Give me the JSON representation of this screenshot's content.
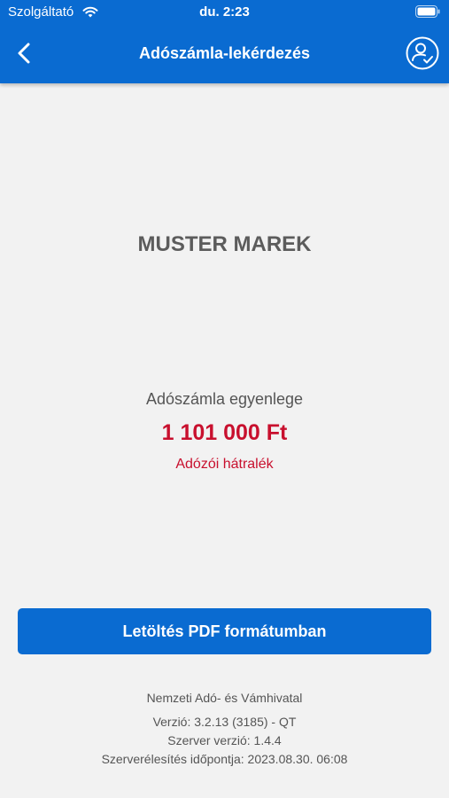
{
  "status_bar": {
    "carrier": "Szolgáltató",
    "time": "du. 2:23"
  },
  "header": {
    "title": "Adószámla-lekérdezés",
    "back_icon": "chevron-left-icon",
    "profile_icon": "user-check-icon"
  },
  "account": {
    "holder_name": "MUSTER MAREK",
    "balance_label": "Adószámla egyenlege",
    "balance_amount": "1 101 000 Ft",
    "balance_status": "Adózói hátralék"
  },
  "actions": {
    "download_label": "Letöltés PDF formátumban"
  },
  "footer": {
    "agency": "Nemzeti Adó- és Vámhivatal",
    "version": "Verzió: 3.2.13 (3185) - QT",
    "server_version": "Szerver verzió: 1.4.4",
    "server_reach_time": "Szerverélesítés időpontja: 2023.08.30. 06:08"
  },
  "colors": {
    "primary": "#0a6bd1",
    "debt": "#c8102e",
    "background": "#f2f2f2"
  }
}
